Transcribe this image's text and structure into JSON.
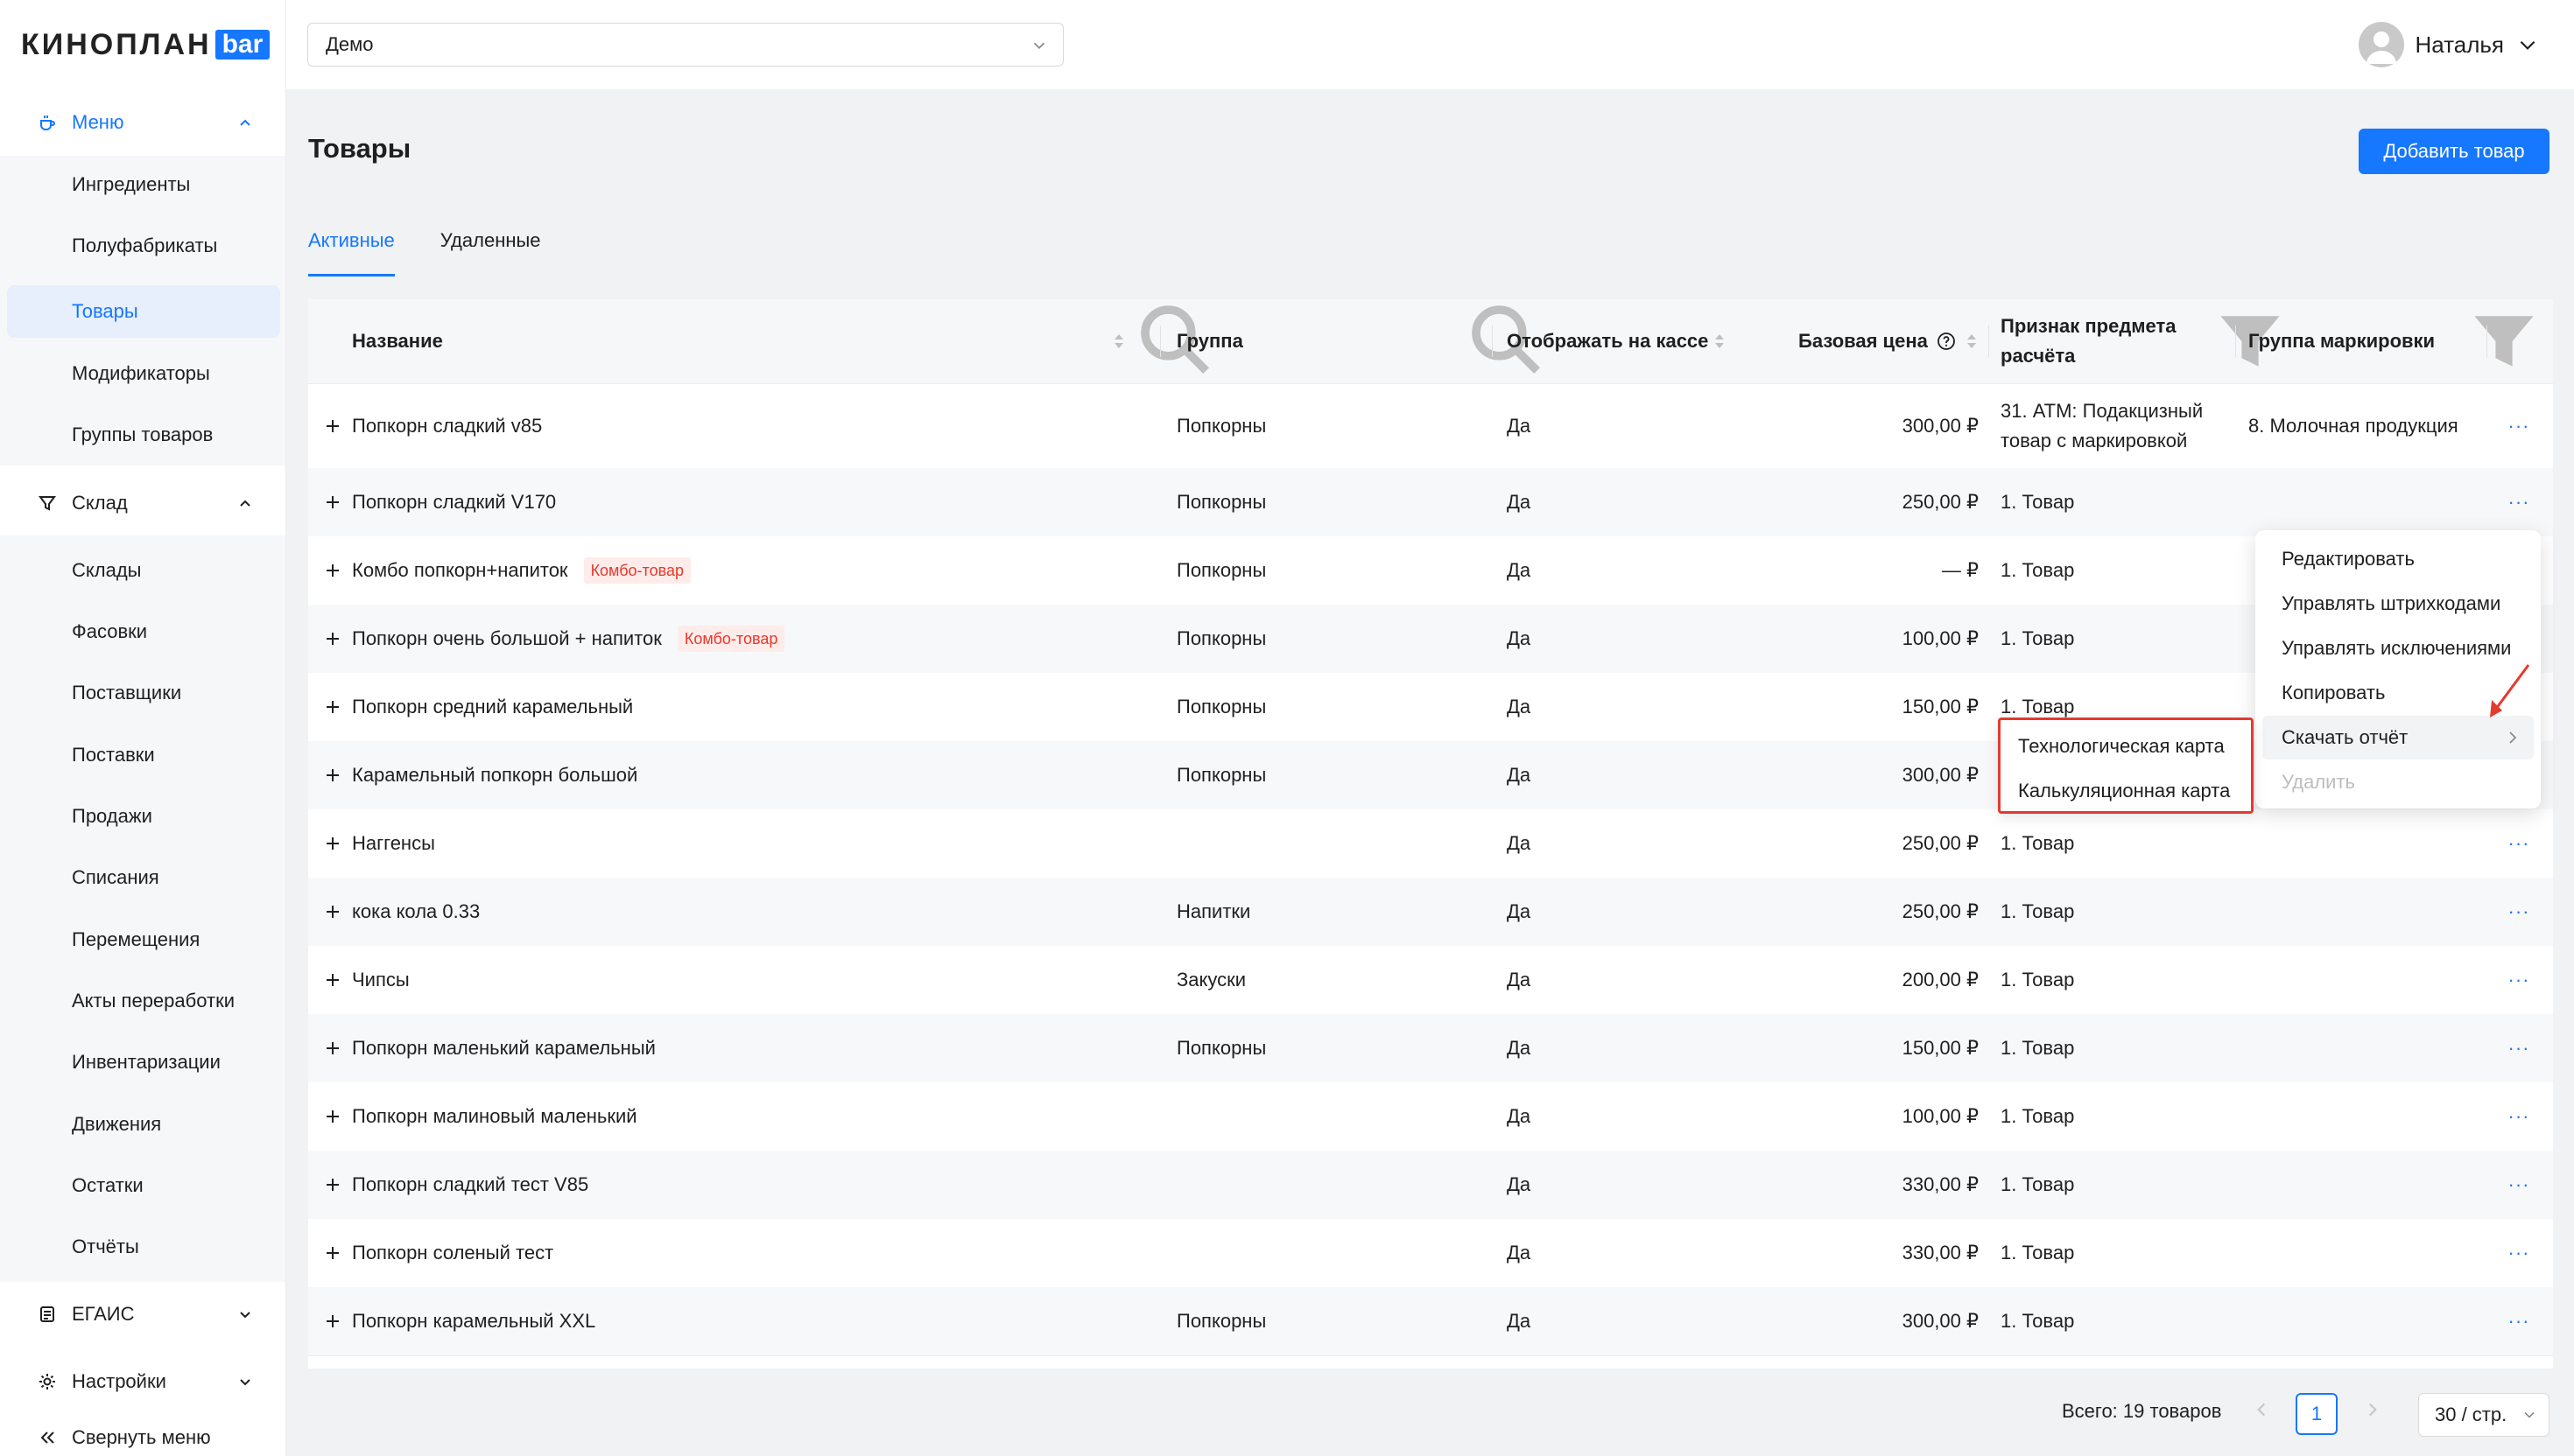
{
  "brand": {
    "word": "КИНОПЛАН",
    "badge": "bar",
    "accent": "#1677ff"
  },
  "sidebar": {
    "sections": [
      {
        "label": "Меню",
        "icon": "coffee-cup-icon",
        "expanded": true
      },
      {
        "label": "Склад",
        "icon": "filter-icon",
        "expanded": true
      },
      {
        "label": "ЕГАИС",
        "icon": "document-icon",
        "expanded": false
      },
      {
        "label": "Настройки",
        "icon": "gear-icon",
        "expanded": false
      }
    ],
    "menu_items": [
      "Ингредиенты",
      "Полуфабрикаты",
      "Товары",
      "Модификаторы",
      "Группы товаров"
    ],
    "warehouse_items": [
      "Склады",
      "Фасовки",
      "Поставщики",
      "Поставки",
      "Продажи",
      "Списания",
      "Перемещения",
      "Акты переработки",
      "Инвентаризации",
      "Движения",
      "Остатки",
      "Отчёты"
    ],
    "collapse_label": "Свернуть меню"
  },
  "header": {
    "org_select": "Демо",
    "user_name": "Наталья"
  },
  "page": {
    "title": "Товары",
    "add_button": "Добавить товар",
    "tabs": [
      "Активные",
      "Удаленные"
    ],
    "active_tab": 0
  },
  "table": {
    "columns": [
      "Название",
      "Группа",
      "Отображать на кассе",
      "Базовая цена",
      "Признак предмета расчёта",
      "Группа маркировки"
    ],
    "rows": [
      {
        "name": "Попкорн сладкий v85",
        "combo": "",
        "group": "Попкорны",
        "pos": "Да",
        "price": "300,00 ₽",
        "sign": "31. АТМ: Подакцизный товар с маркировкой",
        "mark": "8. Молочная продукция"
      },
      {
        "name": "Попкорн сладкий V170",
        "combo": "",
        "group": "Попкорны",
        "pos": "Да",
        "price": "250,00 ₽",
        "sign": "1. Товар",
        "mark": ""
      },
      {
        "name": "Комбо попкорн+напиток",
        "combo": "Комбо-товар",
        "group": "Попкорны",
        "pos": "Да",
        "price": "— ₽",
        "sign": "1. Товар",
        "mark": ""
      },
      {
        "name": "Попкорн очень большой + напиток",
        "combo": "Комбо-товар",
        "group": "Попкорны",
        "pos": "Да",
        "price": "100,00 ₽",
        "sign": "1. Товар",
        "mark": ""
      },
      {
        "name": "Попкорн средний карамельный",
        "combo": "",
        "group": "Попкорны",
        "pos": "Да",
        "price": "150,00 ₽",
        "sign": "1. Товар",
        "mark": ""
      },
      {
        "name": "Карамельный попкорн большой",
        "combo": "",
        "group": "Попкорны",
        "pos": "Да",
        "price": "300,00 ₽",
        "sign": "",
        "mark": ""
      },
      {
        "name": "Наггенсы",
        "combo": "",
        "group": "",
        "pos": "Да",
        "price": "250,00 ₽",
        "sign": "1. Товар",
        "mark": ""
      },
      {
        "name": "кока кола 0.33",
        "combo": "",
        "group": "Напитки",
        "pos": "Да",
        "price": "250,00 ₽",
        "sign": "1. Товар",
        "mark": ""
      },
      {
        "name": "Чипсы",
        "combo": "",
        "group": "Закуски",
        "pos": "Да",
        "price": "200,00 ₽",
        "sign": "1. Товар",
        "mark": ""
      },
      {
        "name": "Попкорн маленький карамельный",
        "combo": "",
        "group": "Попкорны",
        "pos": "Да",
        "price": "150,00 ₽",
        "sign": "1. Товар",
        "mark": ""
      },
      {
        "name": "Попкорн малиновый маленький",
        "combo": "",
        "group": "",
        "pos": "Да",
        "price": "100,00 ₽",
        "sign": "1. Товар",
        "mark": ""
      },
      {
        "name": "Попкорн сладкий тест V85",
        "combo": "",
        "group": "",
        "pos": "Да",
        "price": "330,00 ₽",
        "sign": "1. Товар",
        "mark": ""
      },
      {
        "name": "Попкорн соленый тест",
        "combo": "",
        "group": "",
        "pos": "Да",
        "price": "330,00 ₽",
        "sign": "1. Товар",
        "mark": ""
      },
      {
        "name": "Попкорн карамельный XXL",
        "combo": "",
        "group": "Попкорны",
        "pos": "Да",
        "price": "300,00 ₽",
        "sign": "1. Товар",
        "mark": ""
      }
    ],
    "more_glyph": "···"
  },
  "context_menu": {
    "items": [
      "Редактировать",
      "Управлять штрихкодами",
      "Управлять исключениями",
      "Копировать",
      "Скачать отчёт",
      "Удалить"
    ],
    "submenu": [
      "Технологическая карта",
      "Калькуляционная карта"
    ]
  },
  "pagination": {
    "total": "Всего: 19 товаров",
    "current_page": "1",
    "page_size": "30 / стр."
  },
  "colors": {
    "accent": "#1677ff",
    "combo_tag": "#e8382b",
    "highlight_border": "#e53a2f"
  }
}
